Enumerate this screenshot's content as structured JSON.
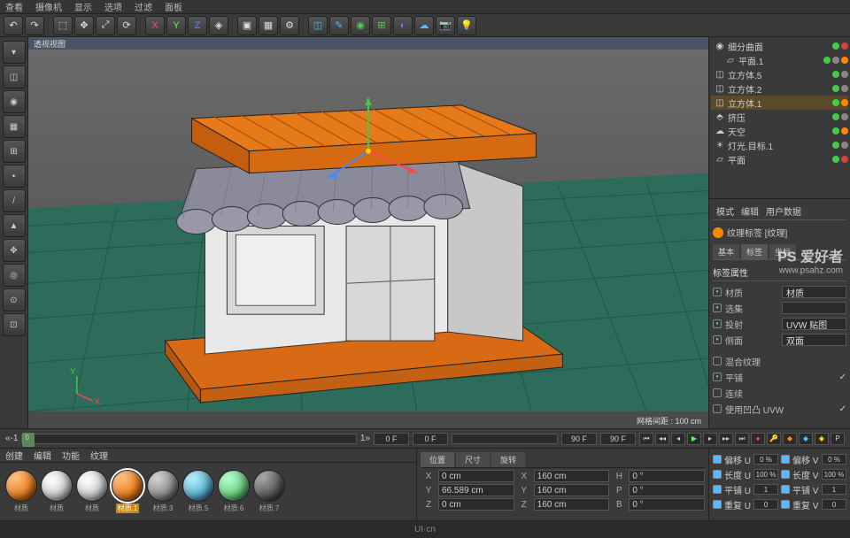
{
  "menubar": [
    "查看",
    "摄像机",
    "显示",
    "选项",
    "过滤",
    "面板"
  ],
  "vp_title": "透视视图",
  "grid_status": "网格间距 : 100 cm",
  "objects": [
    {
      "name": "细分曲面",
      "icon": "#8af",
      "sel": false,
      "dots": [
        "#4c4",
        "#c44"
      ]
    },
    {
      "name": "平面.1",
      "icon": "#8af",
      "sel": false,
      "dots": [
        "#4c4",
        "#c44",
        "#888",
        "#f80"
      ]
    },
    {
      "name": "立方体.5",
      "icon": "#888",
      "sel": false,
      "dots": [
        "#4c4",
        "#c44",
        "#888"
      ]
    },
    {
      "name": "立方体.2",
      "icon": "#888",
      "sel": false,
      "dots": [
        "#4c4",
        "#c44",
        "#888"
      ]
    },
    {
      "name": "立方体.1",
      "icon": "#888",
      "sel": true,
      "dots": [
        "#4c4",
        "#c44",
        "#f80"
      ]
    },
    {
      "name": "挤压",
      "icon": "#8af",
      "sel": false,
      "dots": [
        "#4c4",
        "#c44",
        "#888"
      ]
    },
    {
      "name": "天空",
      "icon": "#888",
      "sel": false,
      "dots": [
        "#4c4",
        "#c44",
        "#888",
        "#f80"
      ]
    },
    {
      "name": "灯光.目标.1",
      "icon": "#fff",
      "sel": false,
      "dots": [
        "#4c4",
        "#c44",
        "#888"
      ]
    },
    {
      "name": "平面",
      "icon": "#8af",
      "sel": false,
      "dots": [
        "#4c4",
        "#c44"
      ]
    }
  ],
  "attr": {
    "mode": "模式",
    "edit": "编辑",
    "userdata": "用户数据",
    "tag_title": "纹理标签 [纹理]",
    "tabs": [
      "基本",
      "标签",
      "坐标"
    ],
    "section": "标签属性",
    "rows": [
      {
        "label": "材质",
        "val": "材质",
        "chk": true
      },
      {
        "label": "选集",
        "val": "",
        "chk": true
      },
      {
        "label": "投射",
        "val": "UVW 贴图",
        "chk": true
      },
      {
        "label": "侧面",
        "val": "双面",
        "chk": true
      }
    ],
    "rows2": [
      {
        "label": "混合纹理",
        "chk": false
      },
      {
        "label": "平铺",
        "chk": true
      },
      {
        "label": "连续",
        "chk": false
      },
      {
        "label": "使用凹凸 UVW",
        "chk": false
      }
    ]
  },
  "timeline": {
    "start": "0 F",
    "cur": "0 F",
    "end": "90 F",
    "range_end": "90 F",
    "marker": "0"
  },
  "transform": {
    "rows": [
      {
        "l1": "偏移 U",
        "v1": "0 %",
        "l2": "偏移 V",
        "v2": "0 %"
      },
      {
        "l1": "长度 U",
        "v1": "100 %",
        "l2": "长度 V",
        "v2": "100 %"
      },
      {
        "l1": "平铺 U",
        "v1": "1",
        "l2": "平铺 V",
        "v2": "1"
      },
      {
        "l1": "重复 U",
        "v1": "0",
        "l2": "重复 V",
        "v2": "0"
      }
    ]
  },
  "mat_menu": [
    "创建",
    "编辑",
    "功能",
    "纹理"
  ],
  "materials": [
    {
      "color": "#e67a1a",
      "label": "材质",
      "sel": false
    },
    {
      "color": "#ccc",
      "label": "材质",
      "sel": false
    },
    {
      "color": "#ccc",
      "label": "材质",
      "sel": false
    },
    {
      "color": "#e67a1a",
      "label": "材质.1",
      "sel": true
    },
    {
      "color": "#888",
      "label": "材质.3",
      "sel": false
    },
    {
      "color": "#5ac",
      "label": "材质.5",
      "sel": false
    },
    {
      "color": "#6c7",
      "label": "材质.6",
      "sel": false
    },
    {
      "color": "#555",
      "label": "材质.7",
      "sel": false
    }
  ],
  "coord": {
    "tabs": [
      "位置",
      "尺寸",
      "旋转"
    ],
    "header": [
      "位置",
      "尺寸",
      "旋转"
    ],
    "rows": [
      [
        "X",
        "0 cm",
        "X",
        "160 cm",
        "H",
        "0 °"
      ],
      [
        "Y",
        "66.589 cm",
        "Y",
        "160 cm",
        "P",
        "0 °"
      ],
      [
        "Z",
        "0 cm",
        "Z",
        "160 cm",
        "B",
        "0 °"
      ]
    ]
  },
  "footer": "UI·cn",
  "watermark": {
    "big": "PS 爱好者",
    "small": "www.psahz.com"
  },
  "axis": {
    "x": "X",
    "y": "Y"
  },
  "tl_neg": "«-1",
  "tl_pos": "1»"
}
